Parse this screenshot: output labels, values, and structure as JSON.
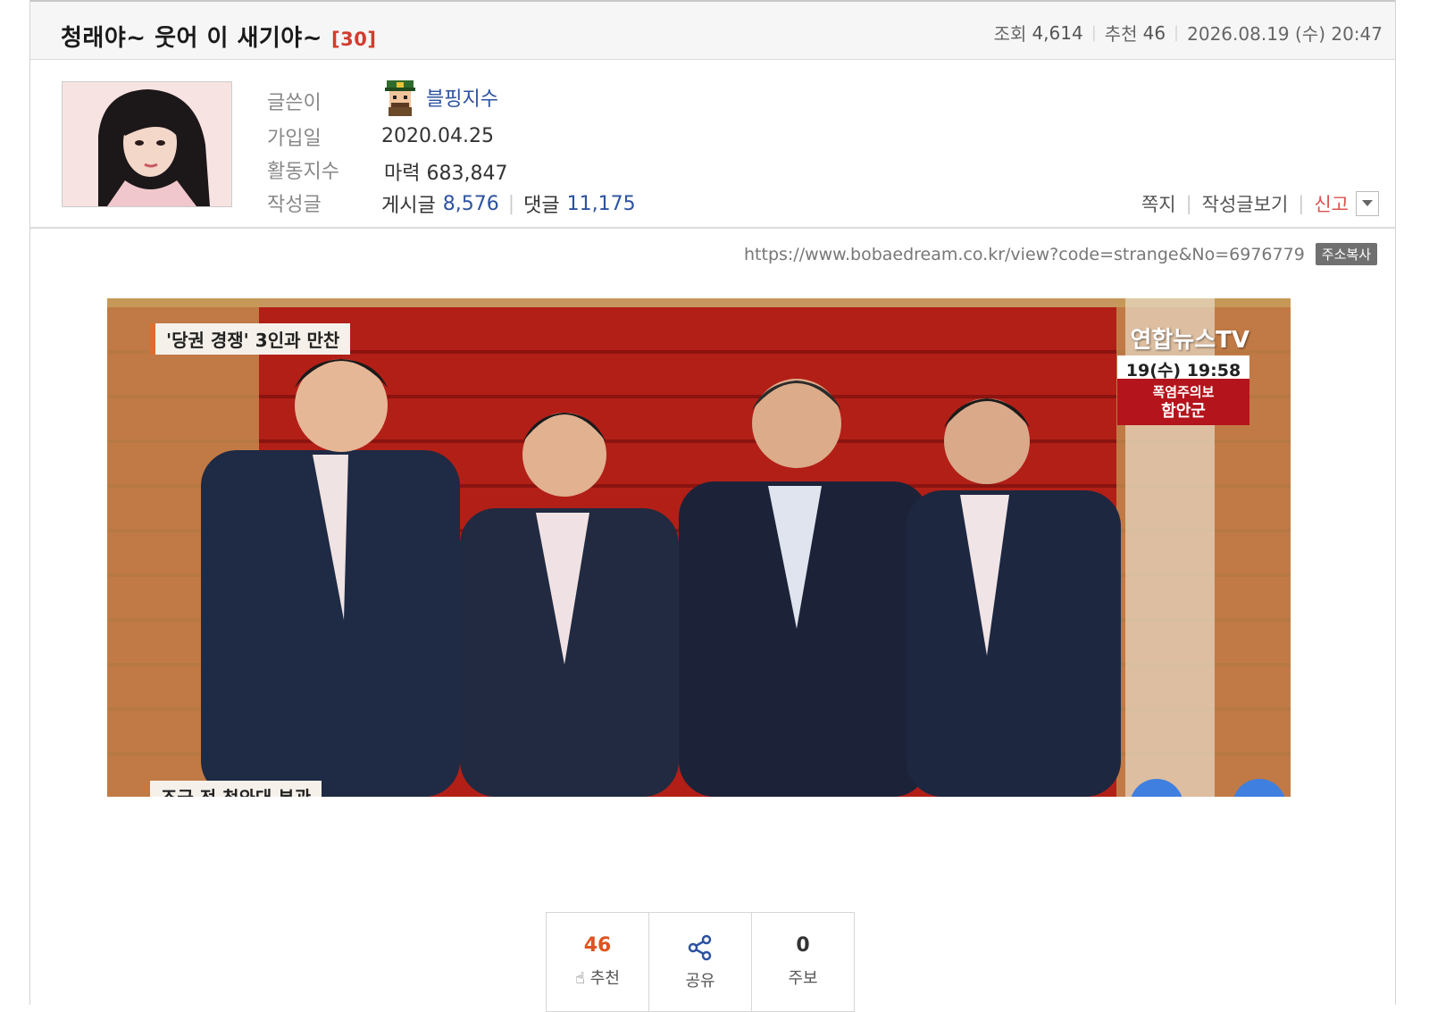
{
  "post": {
    "title": "청래야~ 웃어 이 새기야~",
    "comment_count": "[30]",
    "views_label": "조회",
    "views": "4,614",
    "recommend_label": "추천",
    "recommend": "46",
    "datetime": "2026.08.19 (수) 20:47"
  },
  "author": {
    "writer_label": "글쓴이",
    "nickname": "블핑지수",
    "joined_label": "가입일",
    "joined": "2020.04.25",
    "activity_label": "활동지수",
    "activity_value": "마력 683,847",
    "posts_label": "작성글",
    "posts_word": "게시글",
    "posts_count": "8,576",
    "comments_word": "댓글",
    "comments_count": "11,175"
  },
  "actions": {
    "message": "쪽지",
    "view_posts": "작성글보기",
    "report": "신고"
  },
  "url": {
    "text": "https://www.bobaedream.co.kr/view?code=strange&No=6976779",
    "copy_label": "주소복사"
  },
  "news_image": {
    "caption_top": "'당권 경쟁' 3인과 만찬",
    "caption_bottom": "조금 전 청와대 본관",
    "channel": "연합뉴스TV",
    "time": "19(수) 19:58",
    "alert_line1": "폭염주의보",
    "alert_line2": "함안군"
  },
  "vote": {
    "recommend_count": "46",
    "recommend_label": "추천",
    "share_label": "공유",
    "report_count": "0",
    "report_label": "주보"
  },
  "colors": {
    "accent_blue": "#2d52a0",
    "comment_red": "#d33b2e",
    "report_red": "#d9534f",
    "vote_orange": "#e0541f"
  }
}
